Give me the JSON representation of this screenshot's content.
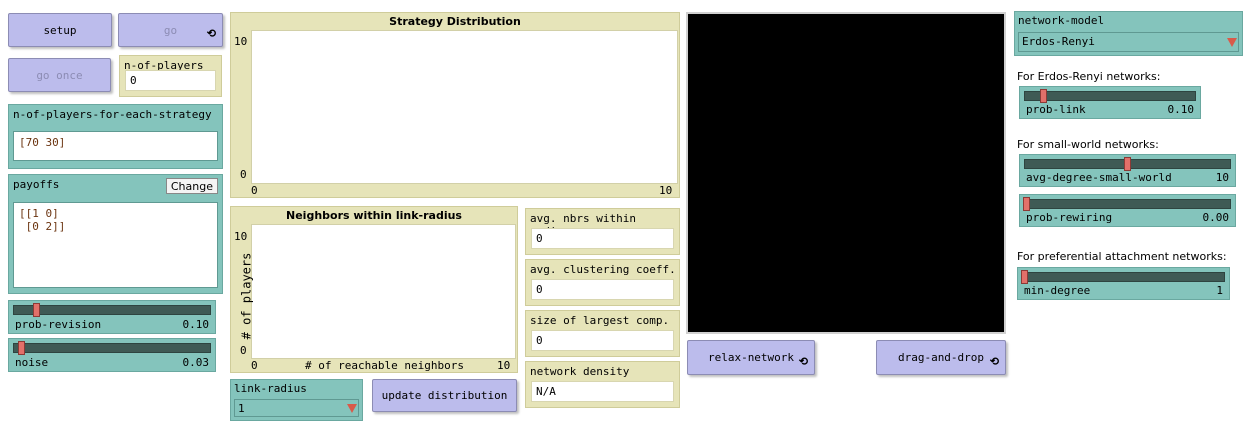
{
  "buttons": {
    "setup": "setup",
    "go": "go",
    "go_once": "go once",
    "relax_network": "relax-network",
    "drag_and_drop": "drag-and-drop",
    "update_distribution": "update distribution",
    "forever_glyph": "⟲"
  },
  "monitors": {
    "n_of_players": {
      "label": "n-of-players",
      "value": "0"
    },
    "avg_nbrs": {
      "label": "avg. nbrs within radius",
      "value": "0"
    },
    "avg_clustering": {
      "label": "avg. clustering coeff.",
      "value": "0"
    },
    "largest_comp": {
      "label": "size of largest comp.",
      "value": "0"
    },
    "network_density": {
      "label": "network density",
      "value": "N/A"
    }
  },
  "inputs": {
    "n_players_each_strategy": {
      "label": "n-of-players-for-each-strategy",
      "value": "[70 30]"
    },
    "payoffs": {
      "label": "payoffs",
      "change_label": "Change",
      "value": "[[1 0]\n [0 2]]"
    }
  },
  "sliders": {
    "prob_revision": {
      "label": "prob-revision",
      "value": "0.10",
      "fraction": 0.1
    },
    "noise": {
      "label": "noise",
      "value": "0.03",
      "fraction": 0.03
    },
    "prob_link": {
      "label": "prob-link",
      "value": "0.10",
      "fraction": 0.1
    },
    "avg_degree": {
      "label": "avg-degree-small-world",
      "value": "10",
      "fraction": 0.5
    },
    "prob_rewiring": {
      "label": "prob-rewiring",
      "value": "0.00",
      "fraction": 0.0
    },
    "min_degree": {
      "label": "min-degree",
      "value": "1",
      "fraction": 0.0
    }
  },
  "choosers": {
    "network_model": {
      "label": "network-model",
      "value": "Erdos-Renyi"
    },
    "link_radius": {
      "label": "link-radius",
      "value": "1"
    }
  },
  "notes": {
    "erdos": "For Erdos-Renyi networks:",
    "small_world": "For small-world networks:",
    "preferential": "For preferential attachment networks:"
  },
  "plots": {
    "strategy": {
      "title": "Strategy Distribution",
      "ymax": "10",
      "ymin": "0",
      "xmin": "0",
      "xmax": "10"
    },
    "neighbors": {
      "title": "Neighbors within link-radius",
      "ylabel": "# of players",
      "xlabel": "# of reachable neighbors",
      "ymax": "10",
      "ymin": "0",
      "xmin": "0",
      "xmax": "10"
    }
  },
  "colors": {
    "button": "#bcbcec",
    "monitor": "#e6e4b9",
    "input": "#84c4bc",
    "slider_thumb": "#e2706a",
    "view": "#000000"
  }
}
